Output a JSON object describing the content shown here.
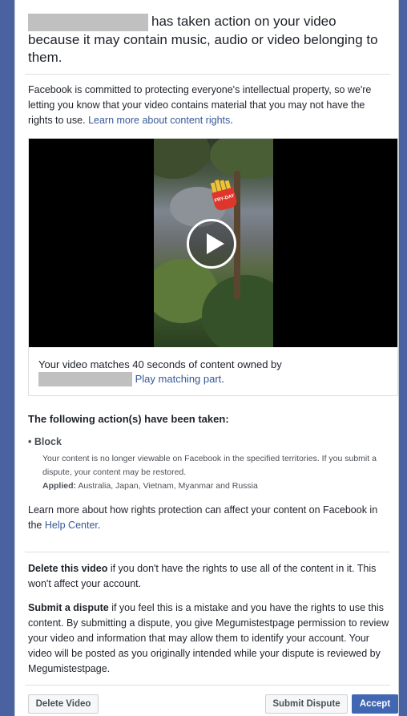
{
  "header": {
    "title_suffix": "has taken action on your video because it may contain music, audio or video belonging to them."
  },
  "intro": {
    "text": "Facebook is committed to protecting everyone's intellectual property, so we're letting you know that your video contains material that you may not have the rights to use.",
    "link": "Learn more about content rights"
  },
  "video": {
    "overlay_text": "FRY-DAY",
    "match_text": "Your video matches 40 seconds of content owned by",
    "play_link": "Play matching part"
  },
  "actions": {
    "title": "The following action(s) have been taken:",
    "name": "Block",
    "description": "Your content is no longer viewable on Facebook in the specified territories. If you submit a dispute, your content may be restored.",
    "applied_label": "Applied:",
    "applied_value": "Australia, Japan, Vietnam, Myanmar and Russia"
  },
  "learn_more": {
    "text": "Learn more about how rights protection can affect your content on Facebook in the",
    "link": "Help Center"
  },
  "delete_info": {
    "bold": "Delete this video",
    "text": "if you don't have the rights to use all of the content in it. This won't affect your account."
  },
  "dispute_info": {
    "bold": "Submit a dispute",
    "text": "if you feel this is a mistake and you have the rights to use this content. By submitting a dispute, you give Megumistestpage permission to review your video and information that may allow them to identify your account. Your video will be posted as you originally intended while your dispute is reviewed by Megumistestpage."
  },
  "buttons": {
    "delete": "Delete Video",
    "submit": "Submit Dispute",
    "accept": "Accept"
  },
  "colors": {
    "brand": "#4267b2",
    "link": "#365899",
    "frame": "#4a63a0"
  }
}
